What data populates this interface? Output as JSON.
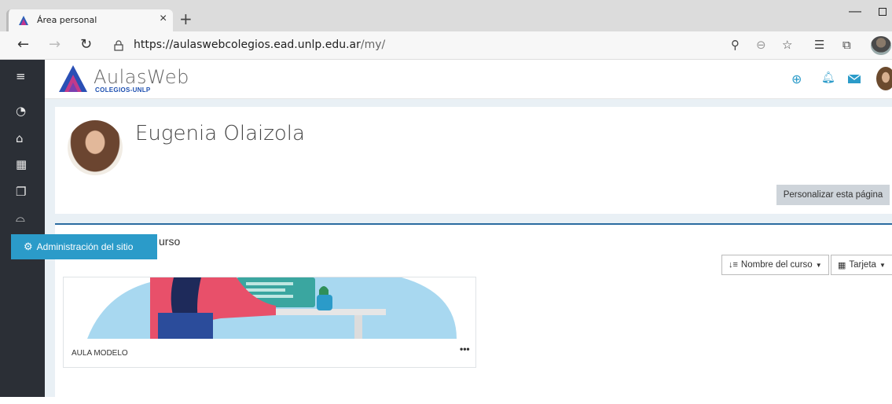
{
  "browser": {
    "tab_title": "Área personal",
    "tab_close": "×",
    "new_tab": "+",
    "minimize": "—",
    "url_host": "https://aulaswebcolegios.ead.unlp.edu.ar",
    "url_path": "/my/"
  },
  "site": {
    "logo_name": "AulasWeb",
    "logo_sub": "COLEGIOS-UNLP"
  },
  "sidebar": {
    "menu_icon": "≡",
    "admin_label": "Administración del sitio"
  },
  "profile": {
    "name": "Eugenia Olaizola",
    "customize_button": "Personalizar esta página"
  },
  "courses": {
    "heading_visible": "urso",
    "sort_label": "Nombre del curso",
    "view_label": "Tarjeta",
    "items": [
      {
        "name": "AULA MODELO",
        "menu": "•••"
      }
    ]
  },
  "colors": {
    "accent": "#2b9bc9",
    "sidebar_bg": "#2b2f36",
    "main_bg": "#e9f0f5",
    "logo_blue": "#1d4fb0"
  }
}
